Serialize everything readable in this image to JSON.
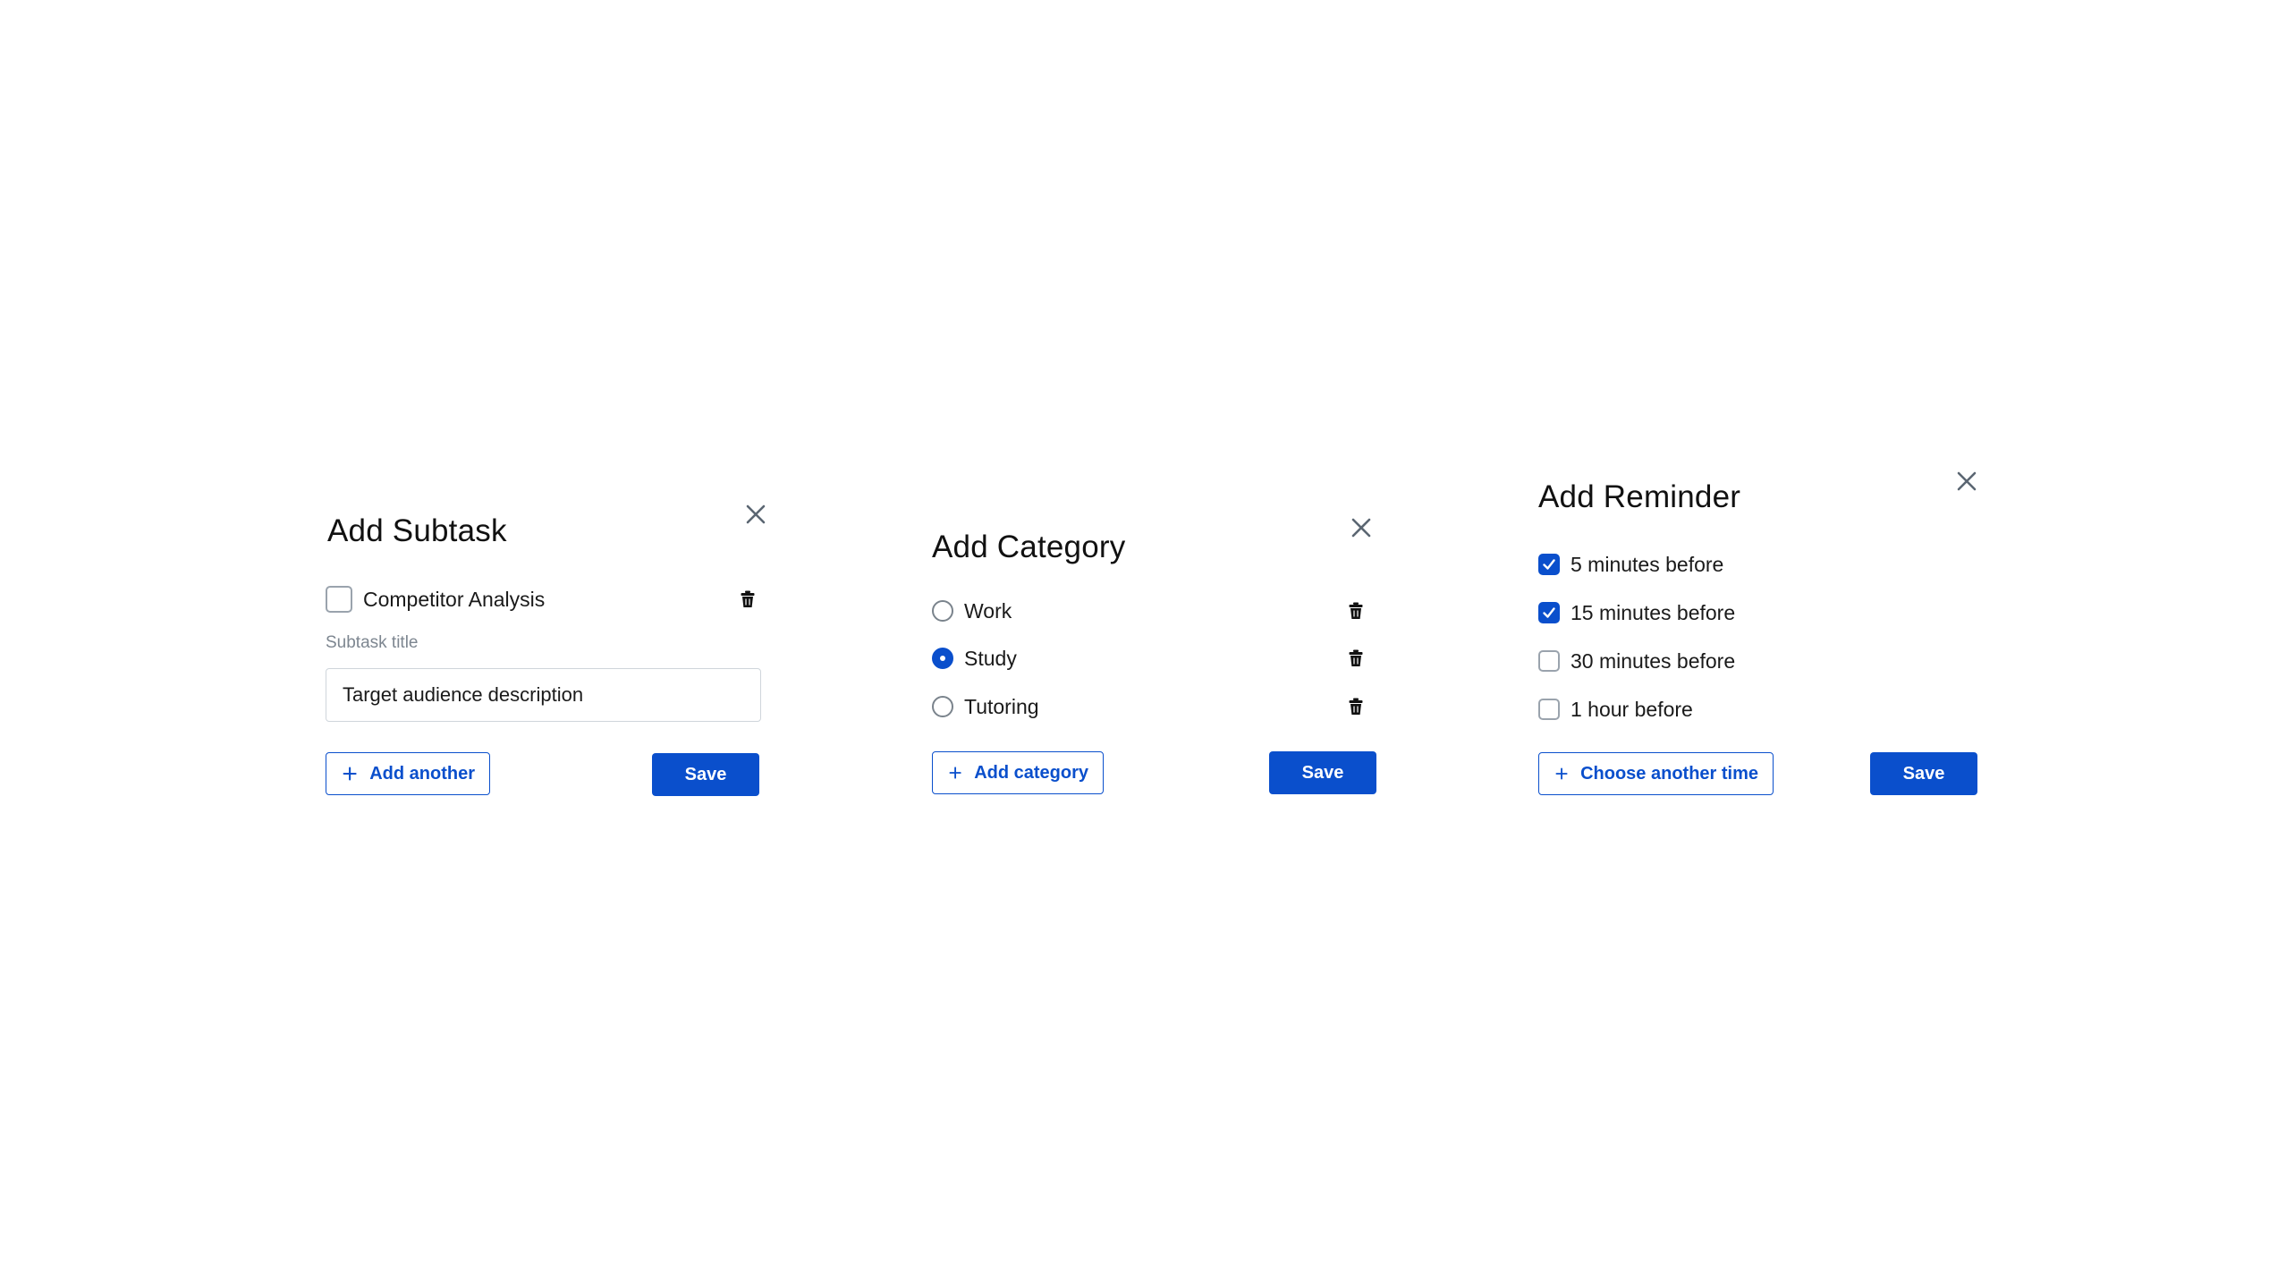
{
  "colors": {
    "accent": "#0a4fcc",
    "text": "#1a1a1a",
    "muted": "#7d8690",
    "border": "#cfd5db"
  },
  "add_subtask": {
    "title": "Add Subtask",
    "close_icon": "close-icon",
    "items": [
      {
        "label": "Competitor Analysis",
        "checked": false,
        "icon": "trash-icon"
      }
    ],
    "field_label": "Subtask title",
    "input_value": "Target audience description",
    "add_button_label": "Add another",
    "save_label": "Save"
  },
  "add_category": {
    "title": "Add Category",
    "close_icon": "close-icon",
    "options": [
      {
        "label": "Work",
        "selected": false,
        "icon": "trash-icon"
      },
      {
        "label": "Study",
        "selected": true,
        "icon": "trash-icon"
      },
      {
        "label": "Tutoring",
        "selected": false,
        "icon": "trash-icon"
      }
    ],
    "add_button_label": "Add category",
    "save_label": "Save"
  },
  "add_reminder": {
    "title": "Add Reminder",
    "close_icon": "close-icon",
    "options": [
      {
        "label": "5 minutes before",
        "checked": true
      },
      {
        "label": "15 minutes before",
        "checked": true
      },
      {
        "label": "30 minutes before",
        "checked": false
      },
      {
        "label": "1 hour before",
        "checked": false
      }
    ],
    "add_button_label": "Choose another time",
    "save_label": "Save"
  }
}
